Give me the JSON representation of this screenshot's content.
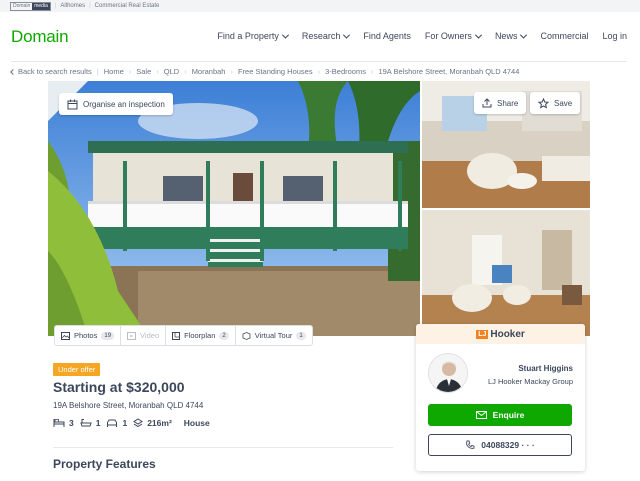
{
  "topstrip": {
    "brand_a": "Domain",
    "brand_b": "media",
    "links": [
      "Allhomes",
      "Commercial Real Estate"
    ]
  },
  "header": {
    "logo": "Domain",
    "nav": [
      {
        "label": "Find a Property",
        "dropdown": true
      },
      {
        "label": "Research",
        "dropdown": true
      },
      {
        "label": "Find Agents",
        "dropdown": false
      },
      {
        "label": "For Owners",
        "dropdown": true
      },
      {
        "label": "News",
        "dropdown": true
      },
      {
        "label": "Commercial",
        "dropdown": false
      },
      {
        "label": "Log in",
        "dropdown": false
      }
    ]
  },
  "breadcrumb": {
    "back": "Back to search results",
    "items": [
      "Home",
      "Sale",
      "QLD",
      "Moranbah",
      "Free Standing Houses",
      "3-Bedrooms",
      "19A Belshore Street, Moranbah QLD 4744"
    ]
  },
  "gallery": {
    "inspection": "Organise an inspection",
    "share": "Share",
    "save": "Save"
  },
  "media_tabs": {
    "photos": {
      "label": "Photos",
      "count": "19"
    },
    "video": {
      "label": "Video"
    },
    "floorplan": {
      "label": "Floorplan",
      "count": "2"
    },
    "tour": {
      "label": "Virtual Tour",
      "count": "1"
    }
  },
  "listing": {
    "status": "Under offer",
    "price": "Starting at $320,000",
    "address": "19A Belshore Street, Moranbah QLD 4744",
    "beds": "3",
    "baths": "1",
    "parking": "1",
    "land": "216m²",
    "type": "House",
    "features_heading": "Property Features"
  },
  "agent": {
    "agency": "Hooker",
    "agency_prefix": "LJ",
    "name": "Stuart Higgins",
    "company": "LJ Hooker Mackay Group",
    "enquire": "Enquire",
    "phone": "04088329 · · ·"
  },
  "colors": {
    "brand_green": "#0ea800",
    "status_orange": "#f5a623",
    "text": "#3c475b",
    "agency_orange": "#f58220"
  }
}
